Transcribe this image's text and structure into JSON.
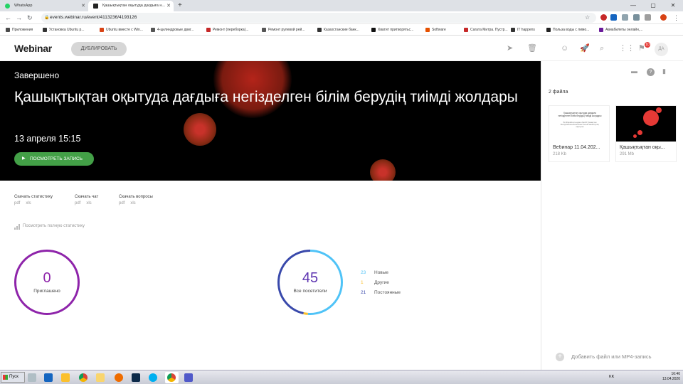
{
  "browser": {
    "tabs": [
      {
        "title": "WhatsApp",
        "favicon_color": "#25d366"
      },
      {
        "title": "Қашықтықтан оқытуда дағдыға н...",
        "favicon_color": "#222222"
      }
    ],
    "new_tab": "+",
    "url": "events.webinar.ru/event/4113236/4193126",
    "bookmarks": [
      {
        "label": "Приложения",
        "color": "#4a4a4a"
      },
      {
        "label": "Установка Ubuntu р...",
        "color": "#333333"
      },
      {
        "label": "Ubuntu вместе с Win...",
        "color": "#d84315"
      },
      {
        "label": "4-цилиндровые двиг...",
        "color": "#555555"
      },
      {
        "label": "Ремонт (переборка)...",
        "color": "#c62828"
      },
      {
        "label": "Ремонт рулевой рей...",
        "color": "#555555"
      },
      {
        "label": "Казахстанские банк...",
        "color": "#333333"
      },
      {
        "label": "Хватит притворятьс...",
        "color": "#111111"
      },
      {
        "label": "Software",
        "color": "#e65100"
      },
      {
        "label": "Сагата Митра. Пустр...",
        "color": "#c62828"
      },
      {
        "label": "IT happens",
        "color": "#333333"
      },
      {
        "label": "Польза воды с лимо...",
        "color": "#222222"
      },
      {
        "label": "Авиабилеты онлайн,...",
        "color": "#6a1b9a"
      }
    ]
  },
  "header": {
    "logo": "Webinar",
    "duplicate_button": "ДУБЛИРОВАТЬ",
    "notification_count": "10",
    "avatar_initials": "ДА"
  },
  "event": {
    "status": "Завершено",
    "title": "Қашықтықтан оқытуда дағдыға негізделген білім берудің тиімді жолдары",
    "date": "13 апреля 15:15",
    "watch_button": "ПОСМОТРЕТЬ ЗАПИСЬ"
  },
  "downloads": [
    {
      "label": "Скачать статистику",
      "formats": [
        "pdf",
        "xls"
      ]
    },
    {
      "label": "Скачать чат",
      "formats": [
        "pdf",
        "xls"
      ]
    },
    {
      "label": "Скачать вопросы",
      "formats": [
        "pdf",
        "xls"
      ]
    }
  ],
  "full_stats_link": "Посмотреть полную статистику",
  "stats": {
    "invited": {
      "value": "0",
      "label": "Приглашено",
      "color": "#8e24aa"
    },
    "visitors": {
      "value": "45",
      "label": "Все посетители",
      "segments": [
        {
          "count": 23,
          "label": "Новые",
          "color": "#4fc3f7"
        },
        {
          "count": 1,
          "label": "Другие",
          "color": "#fbc02d"
        },
        {
          "count": 21,
          "label": "Постоянные",
          "color": "#3949ab"
        }
      ]
    }
  },
  "files": {
    "count_label": "2 файла",
    "items": [
      {
        "name": "Вебинар 11.04.202...",
        "size": "218 Kb",
        "thumb_title": "Қашықтықтан оқытуда дағдыға негізделген білім берудің тиімді жолдары",
        "thumb_text": "Әл-Фараби атындағы ҚазҰУ, Қазақстан Республикасы Білім және ғылым министрлігі, оқытушы"
      },
      {
        "name": "Қашықтықтан оқы...",
        "size": "291 Mb"
      }
    ],
    "add_file": "Добавить файл или MP4-запись"
  },
  "taskbar": {
    "start": "Пуск",
    "lang": "KK",
    "time": "16:46",
    "date": "13.04.2020"
  }
}
